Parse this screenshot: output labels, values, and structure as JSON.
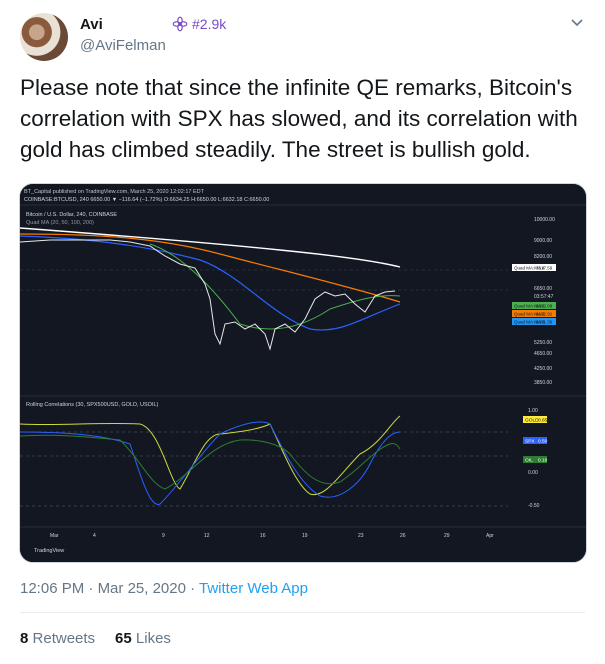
{
  "author": {
    "name": "Avi",
    "handle": "@AviFelman",
    "badge_text": "#2.9k"
  },
  "tweet": {
    "text": "Please note that since the infinite QE remarks, Bitcoin's correlation with SPX has slowed, and its correlation with gold has climbed steadily. The street is bullish gold."
  },
  "media": {
    "header_line1": "BT_Capital published on TradingView.com, March 25, 2020 12:02:17 EDT",
    "header_line2": "COINBASE:BTCUSD, 240  6650.00 ▼ −116.64 (−1.72%)  O:6634.25  H:6650.00  L:6632.18  C:6650.00",
    "price_panel_title": "Bitcoin / U.S. Dollar, 240, COINBASE",
    "price_panel_subtitle": "Quad MA (20, 50, 100, 200)",
    "corr_panel_title": "Rolling Correlations (30, SPX500USD, GOLD, USOIL)",
    "price_axis": [
      "10000.00",
      "9000.00",
      "8200.00",
      "6650.00",
      "03:57:47",
      "5250.00",
      "4650.00",
      "4250.00",
      "3850.00"
    ],
    "price_labels": [
      {
        "text": "Quad MA:MA 4",
        "value": "7617.59",
        "color": "#ffffff"
      },
      {
        "text": "Quad MA:MA 1",
        "value": "6382.09",
        "color": "#4caf50"
      },
      {
        "text": "Quad MA:MA 2",
        "value": "6192.91",
        "color": "#f57c00"
      },
      {
        "text": "Quad MA:MA 3",
        "value": "6091.36",
        "color": "#2196f3"
      }
    ],
    "corr_axis": [
      "1.00",
      "0.00",
      "-0.50"
    ],
    "corr_labels": [
      {
        "text": "GOLD",
        "value": "0.85",
        "color": "#ffeb3b"
      },
      {
        "text": "SPX",
        "value": "0.50",
        "color": "#2962ff"
      },
      {
        "text": "OIL",
        "value": "0.18",
        "color": "#2e7d32"
      }
    ],
    "x_axis": [
      "Mar",
      "4",
      "9",
      "12",
      "16",
      "19",
      "23",
      "26",
      "29",
      "Apr"
    ],
    "footer": "TradingView"
  },
  "meta": {
    "time": "12:06 PM",
    "separator": " · ",
    "date": "Mar 25, 2020",
    "app": "Twitter Web App"
  },
  "stats": {
    "retweets_count": "8",
    "retweets_label": "Retweets",
    "likes_count": "65",
    "likes_label": "Likes"
  }
}
